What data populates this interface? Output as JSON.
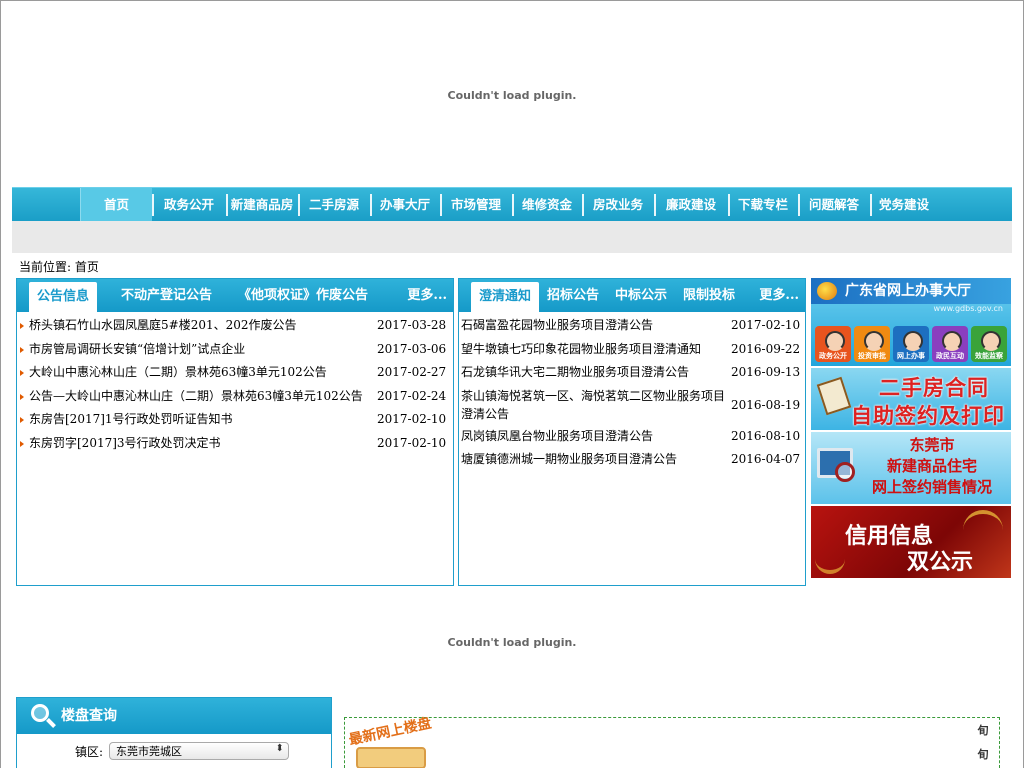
{
  "plugin_message": "Couldn't load plugin.",
  "nav": {
    "items": [
      "首页",
      "政务公开",
      "新建商品房",
      "二手房源",
      "办事大厅",
      "市场管理",
      "维修资金",
      "房改业务",
      "廉政建设",
      "下载专栏",
      "问题解答",
      "党务建设"
    ]
  },
  "breadcrumb": {
    "label": "当前位置:",
    "current": "首页"
  },
  "panel_left": {
    "tabs": [
      "公告信息",
      "不动产登记公告",
      "《他项权证》作废公告"
    ],
    "more": "更多...",
    "rows": [
      {
        "title": "桥头镇石竹山水园凤凰庭5#楼201、202作废公告",
        "date": "2017-03-28"
      },
      {
        "title": "市房管局调研长安镇“倍增计划”试点企业",
        "date": "2017-03-06"
      },
      {
        "title": "大岭山中惠沁林山庄（二期）景林苑63幢3单元102公告",
        "date": "2017-02-27"
      },
      {
        "title": "公告—大岭山中惠沁林山庄（二期）景林苑63幢3单元102公告",
        "date": "2017-02-24"
      },
      {
        "title": "东房告[2017]1号行政处罚听证告知书",
        "date": "2017-02-10"
      },
      {
        "title": "东房罚字[2017]3号行政处罚决定书",
        "date": "2017-02-10"
      }
    ]
  },
  "panel_right": {
    "tabs": [
      "澄清通知",
      "招标公告",
      "中标公示",
      "限制投标"
    ],
    "more": "更多...",
    "rows": [
      {
        "title": "石碣富盈花园物业服务项目澄清公告",
        "date": "2017-02-10"
      },
      {
        "title": "望牛墩镇七巧印象花园物业服务项目澄清通知",
        "date": "2016-09-22"
      },
      {
        "title": "石龙镇华讯大宅二期物业服务项目澄清公告",
        "date": "2016-09-13"
      },
      {
        "title": "茶山镇海悦茗筑一区、海悦茗筑二区物业服务项目澄清公告",
        "date": "2016-08-19"
      },
      {
        "title": "凤岗镇凤凰台物业服务项目澄清公告",
        "date": "2016-08-10"
      },
      {
        "title": "塘厦镇德洲城一期物业服务项目澄清公告",
        "date": "2016-04-07"
      }
    ]
  },
  "banners": {
    "hall": {
      "title": "广东省网上办事大厅",
      "url": "www.gdbs.gov.cn",
      "icons": [
        {
          "label": "政务公开",
          "color": "#e8541e"
        },
        {
          "label": "投资审批",
          "color": "#f08a12"
        },
        {
          "label": "网上办事",
          "color": "#1d6fc0"
        },
        {
          "label": "政民互动",
          "color": "#8a3fbf"
        },
        {
          "label": "效能监察",
          "color": "#3aa33a"
        }
      ]
    },
    "contract": {
      "line1": "二手房合同",
      "line2": "自助签约及打印"
    },
    "sales": {
      "line1": "东莞市",
      "line2": "新建商品住宅",
      "line3": "网上签约销售情况"
    },
    "credit": {
      "line1": "信用信息",
      "line2": "双公示"
    }
  },
  "query": {
    "title": "楼盘查询",
    "town_label": "镇区:",
    "town_value": "东莞市莞城区"
  },
  "news": {
    "stamp": "最新网上楼盘",
    "side": [
      "旬",
      "旬"
    ]
  }
}
